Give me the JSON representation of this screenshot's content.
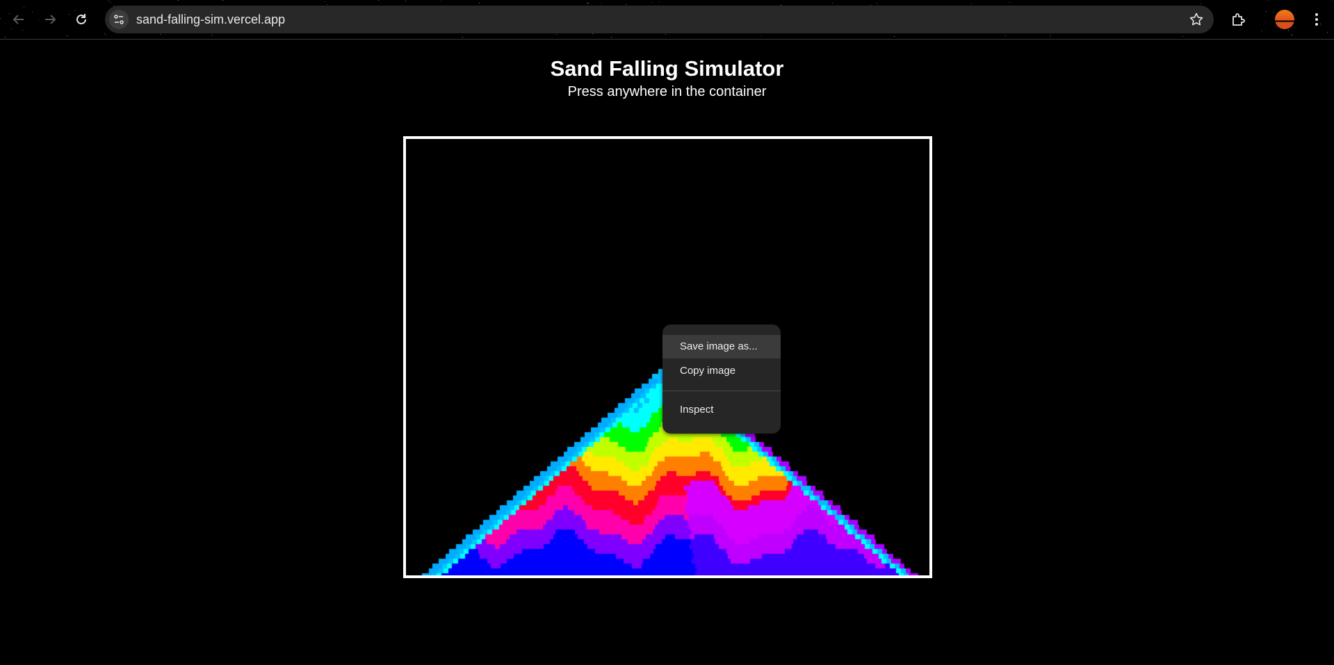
{
  "browser": {
    "url": "sand-falling-sim.vercel.app",
    "icons": {
      "back": "arrow-left-icon",
      "forward": "arrow-right-icon",
      "reload": "reload-icon",
      "site_info": "tune-icon",
      "bookmark": "star-icon",
      "extensions": "puzzle-icon",
      "profile": "avatar",
      "menu": "kebab-menu-icon"
    }
  },
  "page": {
    "title": "Sand Falling Simulator",
    "subtitle": "Press anywhere in the container"
  },
  "context_menu": {
    "items": [
      {
        "label": "Save image as...",
        "highlighted": true
      },
      {
        "label": "Copy image",
        "highlighted": false
      },
      {
        "label": "Inspect",
        "highlighted": false
      }
    ]
  },
  "colors": {
    "background": "#000000",
    "container_border": "#ffffff",
    "omnibox": "#282828",
    "menu_bg": "#262626"
  }
}
